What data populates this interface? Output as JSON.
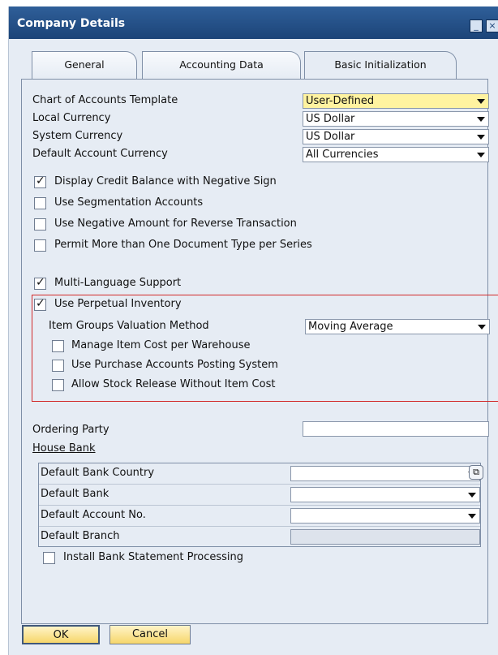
{
  "window": {
    "title": "Company Details",
    "minimize_glyph": "_",
    "close_glyph": "×"
  },
  "tabs": [
    {
      "label": "General",
      "active": false
    },
    {
      "label": "Accounting Data",
      "active": false
    },
    {
      "label": "Basic Initialization",
      "active": true
    }
  ],
  "fields": {
    "coa_template": {
      "label": "Chart of Accounts Template",
      "value": "User-Defined"
    },
    "local_currency": {
      "label": "Local Currency",
      "value": "US Dollar"
    },
    "system_currency": {
      "label": "System Currency",
      "value": "US Dollar"
    },
    "default_account_currency": {
      "label": "Default Account Currency",
      "value": "All Currencies"
    }
  },
  "checkboxes": {
    "display_credit_balance": {
      "label": "Display Credit Balance with Negative Sign",
      "checked": true
    },
    "use_segmentation": {
      "label": "Use Segmentation Accounts",
      "checked": false
    },
    "use_negative_amount": {
      "label": "Use Negative Amount for Reverse Transaction",
      "checked": false
    },
    "permit_more_doc_type": {
      "label": "Permit More than One Document Type per Series",
      "checked": false
    },
    "multi_language": {
      "label": "Multi-Language Support",
      "checked": true
    },
    "perpetual_inventory": {
      "label": "Use Perpetual Inventory",
      "checked": true
    },
    "manage_item_cost": {
      "label": "Manage Item Cost per Warehouse",
      "checked": false
    },
    "purchase_accounts_posting": {
      "label": "Use Purchase Accounts Posting System",
      "checked": false
    },
    "allow_stock_release": {
      "label": "Allow Stock Release Without Item Cost",
      "checked": false
    },
    "install_bank_statement": {
      "label": "Install Bank Statement Processing",
      "checked": false
    }
  },
  "valuation": {
    "label": "Item Groups Valuation Method",
    "value": "Moving Average"
  },
  "ordering_party": {
    "label": "Ordering Party",
    "value": ""
  },
  "house_bank": {
    "title": "House Bank",
    "rows": [
      {
        "label": "Default Bank Country",
        "value": "",
        "dropdown": true
      },
      {
        "label": "Default Bank",
        "value": "",
        "dropdown": true
      },
      {
        "label": "Default Account No.",
        "value": "",
        "dropdown": true
      },
      {
        "label": "Default Branch",
        "value": "",
        "dropdown": false
      }
    ]
  },
  "buttons": {
    "ok": "OK",
    "cancel": "Cancel"
  },
  "colors": {
    "titlebar": "#2f5f99",
    "accent_yellow": "#fff3a0",
    "highlight_border": "#d22a2a"
  }
}
